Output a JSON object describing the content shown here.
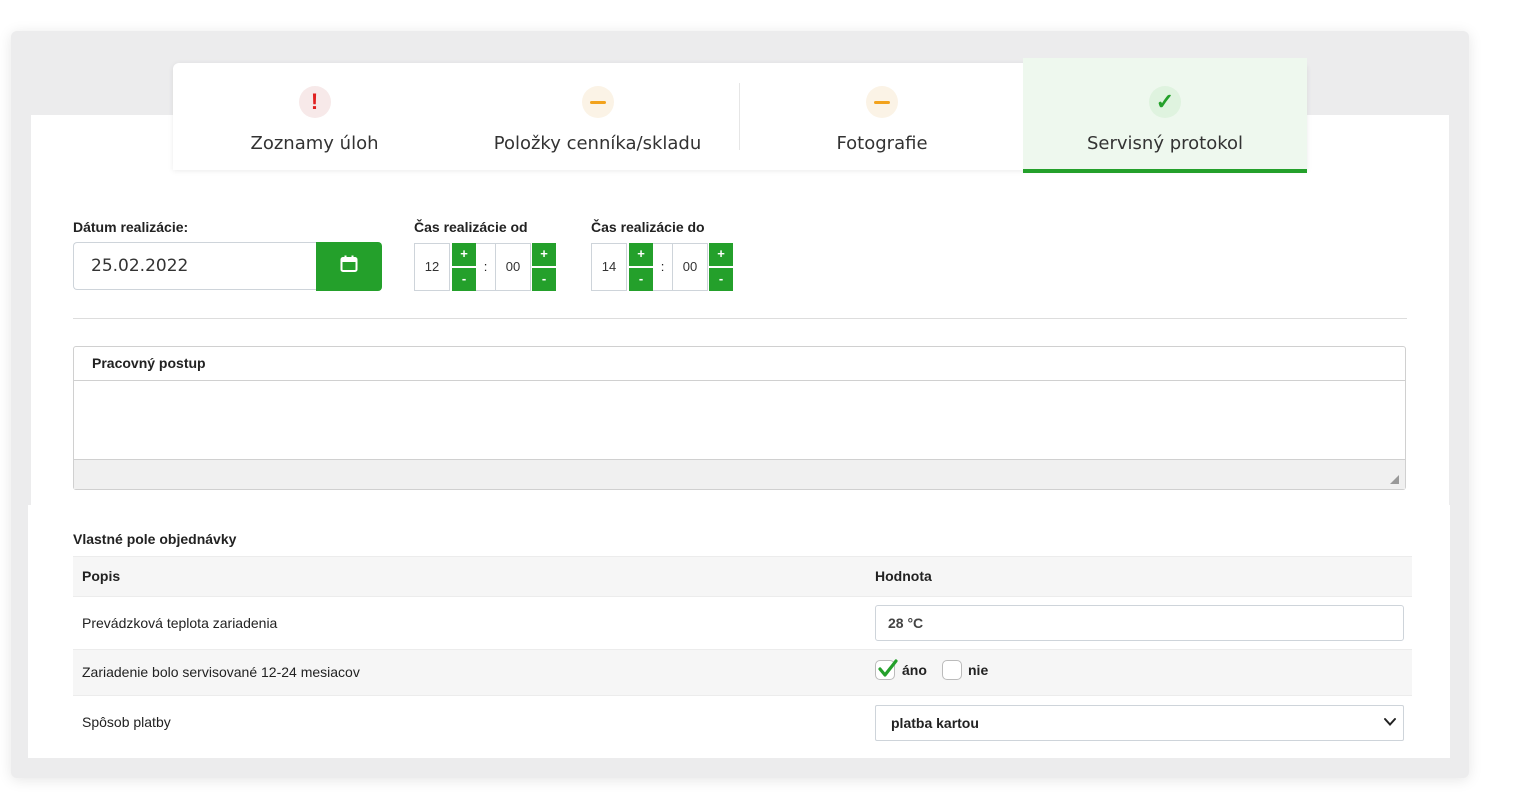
{
  "tabs": [
    {
      "label": "Zoznamy úloh",
      "icon": "exclamation-icon",
      "status": "error"
    },
    {
      "label": "Položky cenníka/skladu",
      "icon": "dash-icon",
      "status": "pending"
    },
    {
      "label": "Fotografie",
      "icon": "dash-icon",
      "status": "pending"
    },
    {
      "label": "Servisný protokol",
      "icon": "check-icon",
      "status": "done",
      "active": true
    }
  ],
  "icons": {
    "error": "!",
    "check": "✓"
  },
  "date": {
    "label": "Dátum realizácie:",
    "value": "25.02.2022",
    "button_icon": "calendar-icon"
  },
  "time_from": {
    "label": "Čas realizácie od",
    "hours": "12",
    "minutes": "00",
    "separator": ":",
    "plus": "+",
    "minus": "-"
  },
  "time_to": {
    "label": "Čas realizácie do",
    "hours": "14",
    "minutes": "00",
    "separator": ":",
    "plus": "+",
    "minus": "-"
  },
  "editor": {
    "title": "Pracovný postup",
    "content": ""
  },
  "custom_fields": {
    "title": "Vlastné pole objednávky",
    "headers": {
      "description": "Popis",
      "value": "Hodnota"
    },
    "rows": [
      {
        "description": "Prevádzková teplota zariadenia",
        "value": "28 °C"
      },
      {
        "description": "Zariadenie bolo servisované 12-24 mesiacov",
        "options": [
          {
            "label": "áno",
            "checked": true
          },
          {
            "label": "nie",
            "checked": false
          }
        ]
      },
      {
        "description": "Spôsob platby",
        "value": "platba kartou"
      }
    ]
  },
  "colors": {
    "accent": "#24a02b",
    "error": "#e02020",
    "warning": "#f2a21c"
  }
}
